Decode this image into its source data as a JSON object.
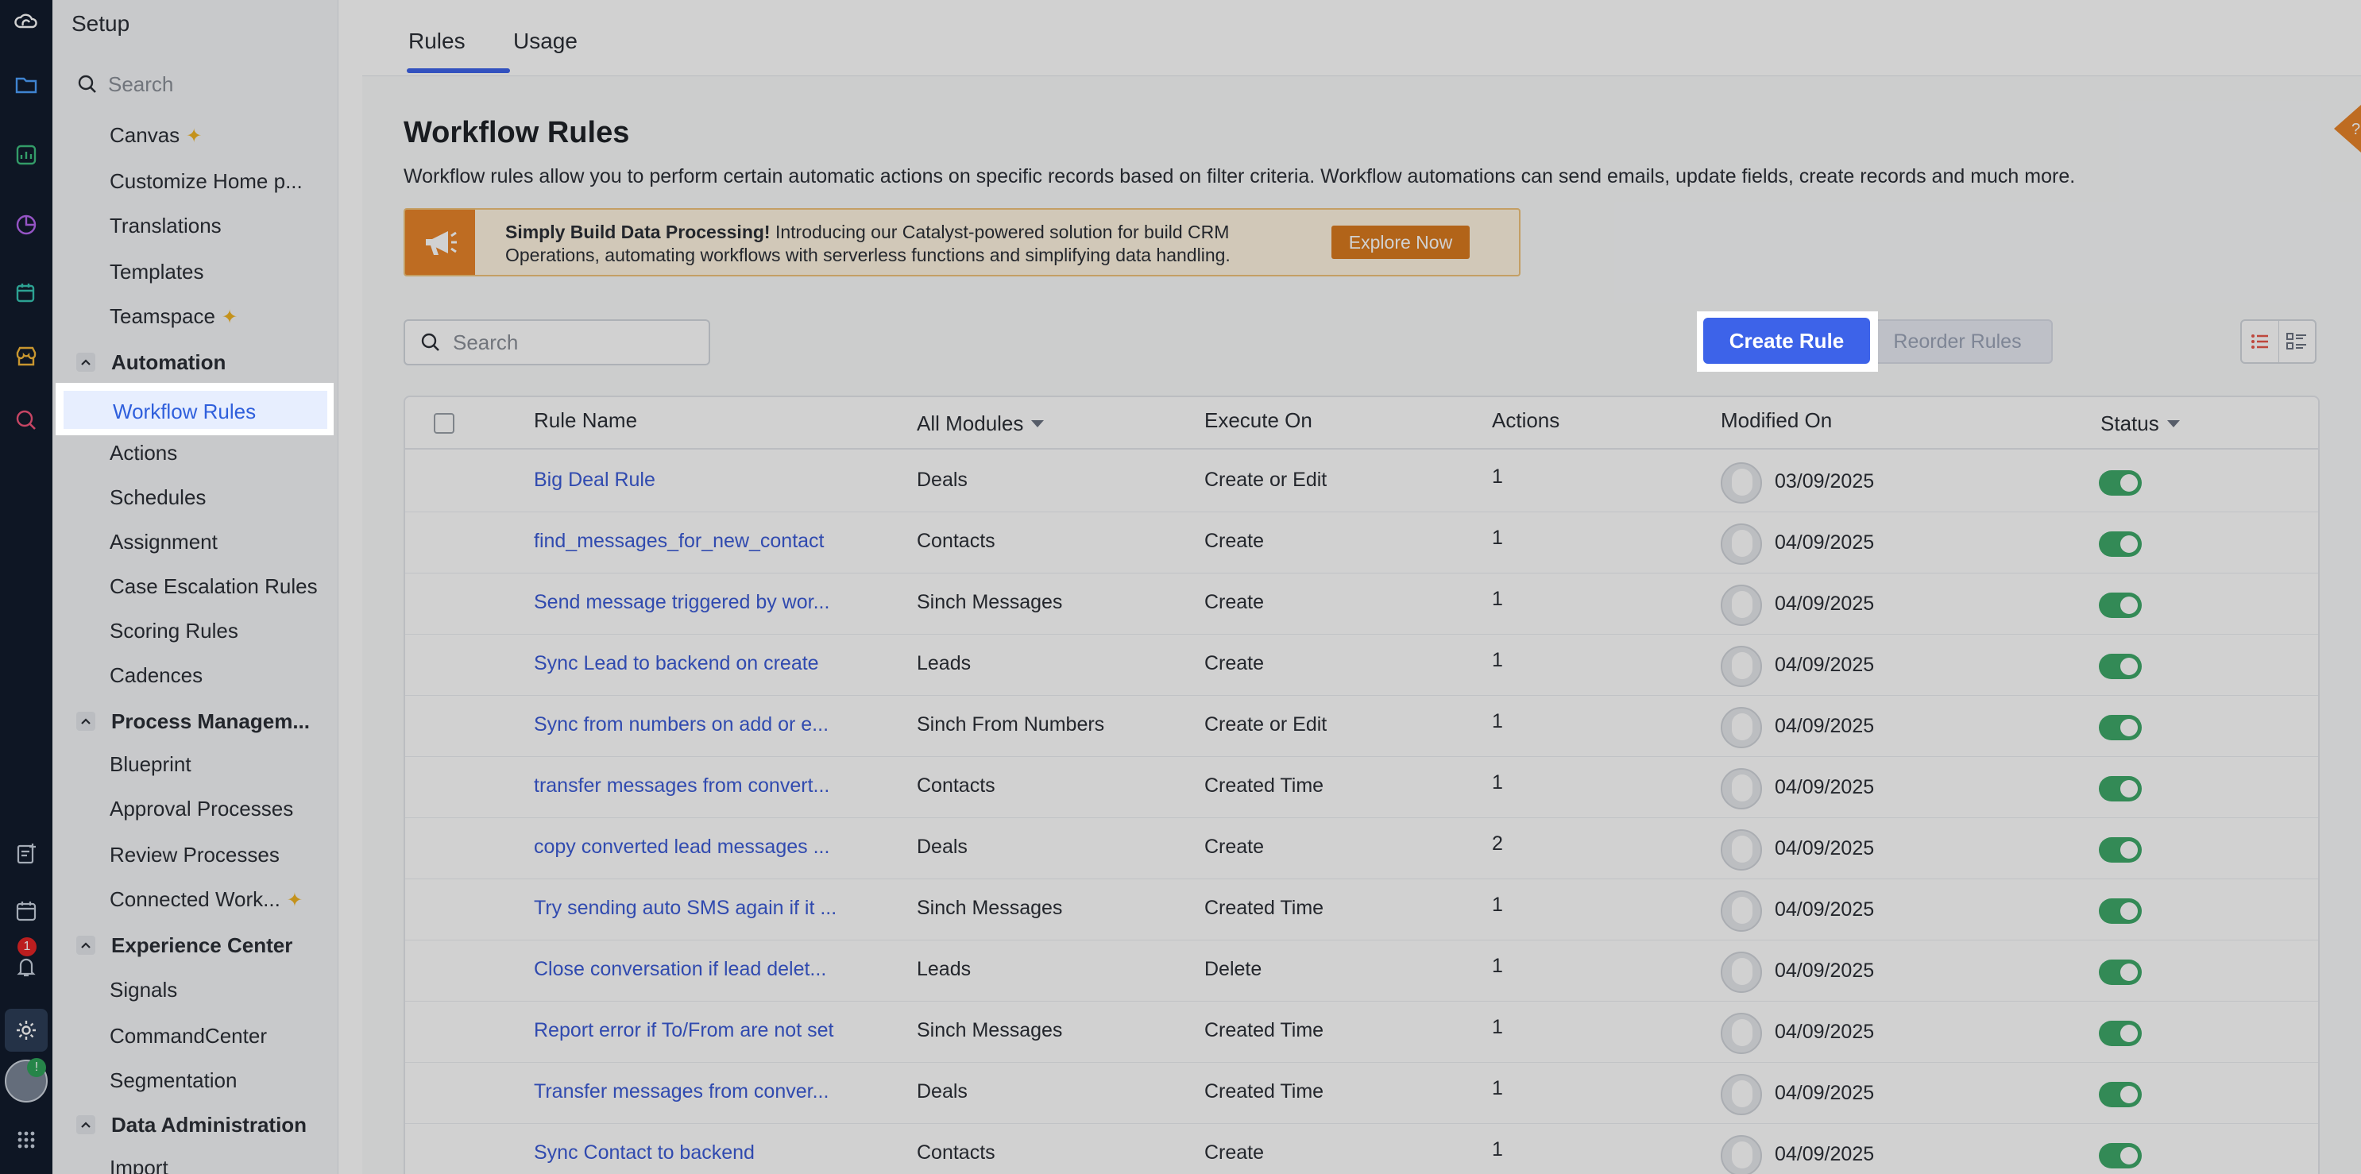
{
  "sidebar": {
    "title": "Setup",
    "search_placeholder": "Search",
    "items_top": [
      {
        "label": "Canvas",
        "spark": true
      },
      {
        "label": "Customize Home p...",
        "spark": false
      },
      {
        "label": "Translations",
        "spark": false
      },
      {
        "label": "Templates",
        "spark": false
      },
      {
        "label": "Teamspace",
        "spark": true
      }
    ],
    "automation": {
      "heading": "Automation",
      "active": "Workflow Rules",
      "items": [
        "Actions",
        "Schedules",
        "Assignment",
        "Case Escalation Rules",
        "Scoring Rules",
        "Cadences"
      ]
    },
    "process": {
      "heading": "Process Managem...",
      "items": [
        "Blueprint",
        "Approval Processes",
        "Review Processes",
        "Connected Work..."
      ]
    },
    "experience": {
      "heading": "Experience Center",
      "items": [
        "Signals",
        "CommandCenter",
        "Segmentation"
      ]
    },
    "data_admin": {
      "heading": "Data Administration",
      "items": [
        "Import"
      ]
    }
  },
  "rail": {
    "notification_count": "1",
    "avatar_badge": "!"
  },
  "tabs": {
    "rules": "Rules",
    "usage": "Usage"
  },
  "page": {
    "title": "Workflow Rules",
    "description": "Workflow rules allow you to perform certain automatic actions on specific records based on filter criteria. Workflow automations can send emails, update fields, create records and much more."
  },
  "banner": {
    "bold": "Simply Build Data Processing!",
    "text": " Introducing our Catalyst-powered solution for build CRM Operations, automating workflows with serverless functions and simplifying data handling.",
    "button": "Explore Now"
  },
  "toolbar": {
    "search_placeholder": "Search",
    "reorder": "Reorder Rules",
    "create": "Create Rule"
  },
  "table": {
    "headers": {
      "rule_name": "Rule Name",
      "module": "All Modules",
      "execute_on": "Execute On",
      "actions": "Actions",
      "modified_on": "Modified On",
      "status": "Status"
    },
    "rows": [
      {
        "name": "Big Deal Rule",
        "module": "Deals",
        "execute": "Create or Edit",
        "actions": "1",
        "modified": "03/09/2025"
      },
      {
        "name": "find_messages_for_new_contact",
        "module": "Contacts",
        "execute": "Create",
        "actions": "1",
        "modified": "04/09/2025"
      },
      {
        "name": "Send message triggered by wor...",
        "module": "Sinch Messages",
        "execute": "Create",
        "actions": "1",
        "modified": "04/09/2025"
      },
      {
        "name": "Sync Lead to backend on create",
        "module": "Leads",
        "execute": "Create",
        "actions": "1",
        "modified": "04/09/2025"
      },
      {
        "name": "Sync from numbers on add or e...",
        "module": "Sinch From Numbers",
        "execute": "Create or Edit",
        "actions": "1",
        "modified": "04/09/2025"
      },
      {
        "name": "transfer messages from convert...",
        "module": "Contacts",
        "execute": "Created Time",
        "actions": "1",
        "modified": "04/09/2025"
      },
      {
        "name": "copy converted lead messages ...",
        "module": "Deals",
        "execute": "Create",
        "actions": "2",
        "modified": "04/09/2025"
      },
      {
        "name": "Try sending auto SMS again if it ...",
        "module": "Sinch Messages",
        "execute": "Created Time",
        "actions": "1",
        "modified": "04/09/2025"
      },
      {
        "name": "Close conversation if lead delet...",
        "module": "Leads",
        "execute": "Delete",
        "actions": "1",
        "modified": "04/09/2025"
      },
      {
        "name": "Report error if To/From are not set",
        "module": "Sinch Messages",
        "execute": "Created Time",
        "actions": "1",
        "modified": "04/09/2025"
      },
      {
        "name": "Transfer messages from conver...",
        "module": "Deals",
        "execute": "Created Time",
        "actions": "1",
        "modified": "04/09/2025"
      },
      {
        "name": "Sync Contact to backend",
        "module": "Contacts",
        "execute": "Create",
        "actions": "1",
        "modified": "04/09/2025"
      }
    ]
  },
  "colors": {
    "accent": "#3d63e9",
    "link": "#3b5bd6",
    "toggle_on": "#3fa96a",
    "banner_orange": "#e8842a",
    "rail": "#121c2d"
  }
}
